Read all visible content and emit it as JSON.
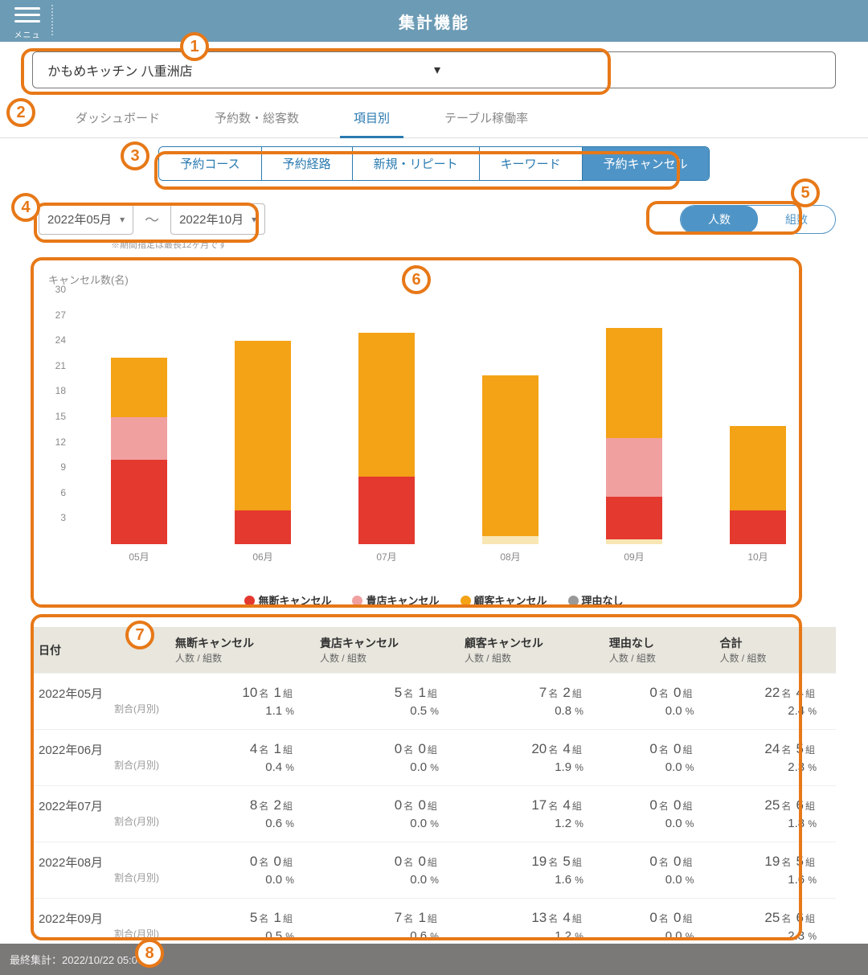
{
  "header": {
    "title": "集計機能",
    "menu_label": "メニュー"
  },
  "store": {
    "selected": "かもめキッチン 八重洲店"
  },
  "main_tabs": [
    {
      "label": "ダッシュボード",
      "active": false
    },
    {
      "label": "予約数・総客数",
      "active": false
    },
    {
      "label": "項目別",
      "active": true
    },
    {
      "label": "テーブル稼働率",
      "active": false
    }
  ],
  "sub_tabs": [
    {
      "label": "予約コース",
      "active": false
    },
    {
      "label": "予約経路",
      "active": false
    },
    {
      "label": "新規・リピート",
      "active": false
    },
    {
      "label": "キーワード",
      "active": false
    },
    {
      "label": "予約キャンセル",
      "active": true
    }
  ],
  "date_range": {
    "from": "2022年05月",
    "to": "2022年10月",
    "sep": "〜",
    "note": "※期間指定は最長12ヶ月です"
  },
  "unit_toggle": {
    "people": "人数",
    "groups": "組数",
    "active": "people"
  },
  "chart_data": {
    "type": "bar",
    "title": "キャンセル数(名)",
    "ylabel": "",
    "ylim": [
      0,
      30
    ],
    "yticks": [
      3,
      6,
      9,
      12,
      15,
      18,
      21,
      24,
      27,
      30
    ],
    "categories": [
      "05月",
      "06月",
      "07月",
      "08月",
      "09月",
      "10月"
    ],
    "series": [
      {
        "name": "無断キャンセル",
        "color": "#e4392f",
        "values": [
          10,
          4,
          8,
          0,
          5,
          4
        ]
      },
      {
        "name": "貴店キャンセル",
        "color": "#f1a0a0",
        "values": [
          5,
          0,
          0,
          0,
          7,
          0
        ]
      },
      {
        "name": "顧客キャンセル",
        "color": "#f4a216",
        "values": [
          7,
          20,
          17,
          19,
          13,
          10
        ]
      },
      {
        "name": "理由なし",
        "color": "#999999",
        "values": [
          0,
          0,
          0,
          0,
          0,
          0
        ]
      }
    ],
    "legend": [
      "無断キャンセル",
      "貴店キャンセル",
      "顧客キャンセル",
      "理由なし"
    ]
  },
  "table": {
    "headers": {
      "date": "日付",
      "cols": [
        "無断キャンセル",
        "貴店キャンセル",
        "顧客キャンセル",
        "理由なし",
        "合計"
      ],
      "sub": "人数 / 組数",
      "ratio_label": "割合(月別)"
    },
    "unit_person": "名",
    "unit_group": "組",
    "unit_pct": "%",
    "rows": [
      {
        "date": "2022年05月",
        "cells": [
          {
            "p": 10,
            "g": 1,
            "pct": "1.1"
          },
          {
            "p": 5,
            "g": 1,
            "pct": "0.5"
          },
          {
            "p": 7,
            "g": 2,
            "pct": "0.8"
          },
          {
            "p": 0,
            "g": 0,
            "pct": "0.0"
          },
          {
            "p": 22,
            "g": 4,
            "pct": "2.4"
          }
        ]
      },
      {
        "date": "2022年06月",
        "cells": [
          {
            "p": 4,
            "g": 1,
            "pct": "0.4"
          },
          {
            "p": 0,
            "g": 0,
            "pct": "0.0"
          },
          {
            "p": 20,
            "g": 4,
            "pct": "1.9"
          },
          {
            "p": 0,
            "g": 0,
            "pct": "0.0"
          },
          {
            "p": 24,
            "g": 5,
            "pct": "2.3"
          }
        ]
      },
      {
        "date": "2022年07月",
        "cells": [
          {
            "p": 8,
            "g": 2,
            "pct": "0.6"
          },
          {
            "p": 0,
            "g": 0,
            "pct": "0.0"
          },
          {
            "p": 17,
            "g": 4,
            "pct": "1.2"
          },
          {
            "p": 0,
            "g": 0,
            "pct": "0.0"
          },
          {
            "p": 25,
            "g": 6,
            "pct": "1.8"
          }
        ]
      },
      {
        "date": "2022年08月",
        "cells": [
          {
            "p": 0,
            "g": 0,
            "pct": "0.0"
          },
          {
            "p": 0,
            "g": 0,
            "pct": "0.0"
          },
          {
            "p": 19,
            "g": 5,
            "pct": "1.6"
          },
          {
            "p": 0,
            "g": 0,
            "pct": "0.0"
          },
          {
            "p": 19,
            "g": 5,
            "pct": "1.6"
          }
        ]
      },
      {
        "date": "2022年09月",
        "cells": [
          {
            "p": 5,
            "g": 1,
            "pct": "0.5"
          },
          {
            "p": 7,
            "g": 1,
            "pct": "0.6"
          },
          {
            "p": 13,
            "g": 4,
            "pct": "1.2"
          },
          {
            "p": 0,
            "g": 0,
            "pct": "0.0"
          },
          {
            "p": 25,
            "g": 6,
            "pct": "2.3"
          }
        ]
      }
    ]
  },
  "footer": {
    "label": "最終集計：",
    "value": "2022/10/22 05:00"
  },
  "callouts": [
    "1",
    "2",
    "3",
    "4",
    "5",
    "6",
    "7",
    "8"
  ]
}
